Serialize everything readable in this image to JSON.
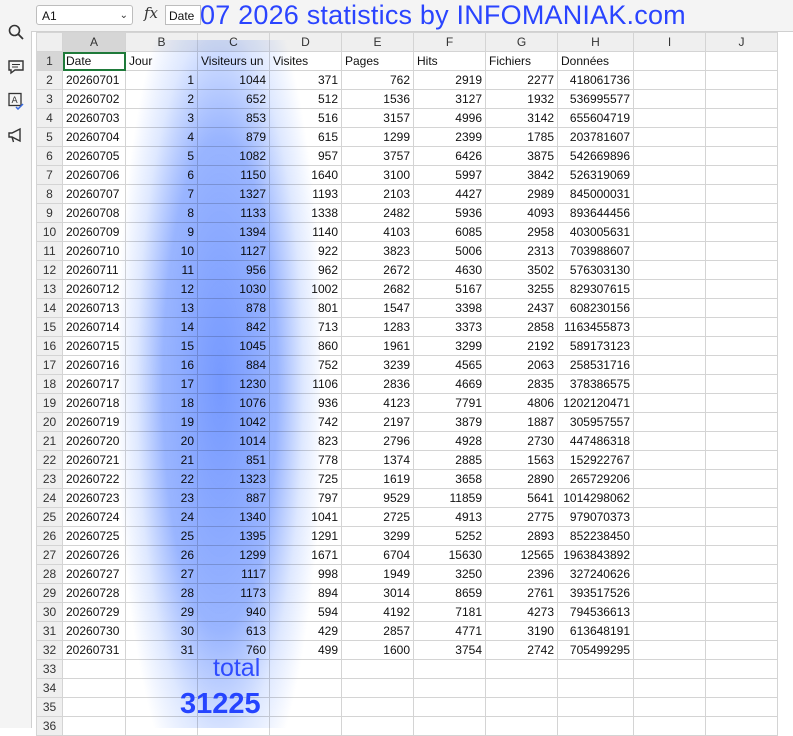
{
  "formula_bar": {
    "cell_ref": "A1",
    "fx_symbol": "fx",
    "content": "Date"
  },
  "overlay": {
    "title": "07 2026   statistics by INFOMANIAK.com",
    "total_label": "total",
    "total_value": "31225"
  },
  "sidebar": {
    "icons": [
      "search-icon",
      "comment-icon",
      "spellcheck-icon",
      "megaphone-icon"
    ]
  },
  "columns": [
    "A",
    "B",
    "C",
    "D",
    "E",
    "F",
    "G",
    "H",
    "I",
    "J"
  ],
  "headers": [
    "Date",
    "Jour",
    "Visiteurs un",
    "Visites",
    "Pages",
    "Hits",
    "Fichiers",
    "Données"
  ],
  "rows": [
    [
      "20260701",
      "1",
      "1044",
      "371",
      "762",
      "2919",
      "2277",
      "418061736"
    ],
    [
      "20260702",
      "2",
      "652",
      "512",
      "1536",
      "3127",
      "1932",
      "536995577"
    ],
    [
      "20260703",
      "3",
      "853",
      "516",
      "3157",
      "4996",
      "3142",
      "655604719"
    ],
    [
      "20260704",
      "4",
      "879",
      "615",
      "1299",
      "2399",
      "1785",
      "203781607"
    ],
    [
      "20260705",
      "5",
      "1082",
      "957",
      "3757",
      "6426",
      "3875",
      "542669896"
    ],
    [
      "20260706",
      "6",
      "1150",
      "1640",
      "3100",
      "5997",
      "3842",
      "526319069"
    ],
    [
      "20260707",
      "7",
      "1327",
      "1193",
      "2103",
      "4427",
      "2989",
      "845000031"
    ],
    [
      "20260708",
      "8",
      "1133",
      "1338",
      "2482",
      "5936",
      "4093",
      "893644456"
    ],
    [
      "20260709",
      "9",
      "1394",
      "1140",
      "4103",
      "6085",
      "2958",
      "403005631"
    ],
    [
      "20260710",
      "10",
      "1127",
      "922",
      "3823",
      "5006",
      "2313",
      "703988607"
    ],
    [
      "20260711",
      "11",
      "956",
      "962",
      "2672",
      "4630",
      "3502",
      "576303130"
    ],
    [
      "20260712",
      "12",
      "1030",
      "1002",
      "2682",
      "5167",
      "3255",
      "829307615"
    ],
    [
      "20260713",
      "13",
      "878",
      "801",
      "1547",
      "3398",
      "2437",
      "608230156"
    ],
    [
      "20260714",
      "14",
      "842",
      "713",
      "1283",
      "3373",
      "2858",
      "1163455873"
    ],
    [
      "20260715",
      "15",
      "1045",
      "860",
      "1961",
      "3299",
      "2192",
      "589173123"
    ],
    [
      "20260716",
      "16",
      "884",
      "752",
      "3239",
      "4565",
      "2063",
      "258531716"
    ],
    [
      "20260717",
      "17",
      "1230",
      "1106",
      "2836",
      "4669",
      "2835",
      "378386575"
    ],
    [
      "20260718",
      "18",
      "1076",
      "936",
      "4123",
      "7791",
      "4806",
      "1202120471"
    ],
    [
      "20260719",
      "19",
      "1042",
      "742",
      "2197",
      "3879",
      "1887",
      "305957557"
    ],
    [
      "20260720",
      "20",
      "1014",
      "823",
      "2796",
      "4928",
      "2730",
      "447486318"
    ],
    [
      "20260721",
      "21",
      "851",
      "778",
      "1374",
      "2885",
      "1563",
      "152922767"
    ],
    [
      "20260722",
      "22",
      "1323",
      "725",
      "1619",
      "3658",
      "2890",
      "265729206"
    ],
    [
      "20260723",
      "23",
      "887",
      "797",
      "9529",
      "11859",
      "5641",
      "1014298062"
    ],
    [
      "20260724",
      "24",
      "1340",
      "1041",
      "2725",
      "4913",
      "2775",
      "979070373"
    ],
    [
      "20260725",
      "25",
      "1395",
      "1291",
      "3299",
      "5252",
      "2893",
      "852238450"
    ],
    [
      "20260726",
      "26",
      "1299",
      "1671",
      "6704",
      "15630",
      "12565",
      "1963843892"
    ],
    [
      "20260727",
      "27",
      "1117",
      "998",
      "1949",
      "3250",
      "2396",
      "327240626"
    ],
    [
      "20260728",
      "28",
      "1173",
      "894",
      "3014",
      "8659",
      "2761",
      "393517526"
    ],
    [
      "20260729",
      "29",
      "940",
      "594",
      "4192",
      "7181",
      "4273",
      "794536613"
    ],
    [
      "20260730",
      "30",
      "613",
      "429",
      "2857",
      "4771",
      "3190",
      "613648191"
    ],
    [
      "20260731",
      "31",
      "760",
      "499",
      "1600",
      "3754",
      "2742",
      "705499295"
    ]
  ],
  "row_numbers": [
    "1",
    "2",
    "3",
    "4",
    "5",
    "6",
    "7",
    "8",
    "9",
    "10",
    "11",
    "12",
    "13",
    "14",
    "15",
    "16",
    "17",
    "18",
    "19",
    "20",
    "21",
    "22",
    "23",
    "24",
    "25",
    "26",
    "27",
    "28",
    "29",
    "30",
    "31",
    "32",
    "33",
    "34",
    "35",
    "36"
  ]
}
